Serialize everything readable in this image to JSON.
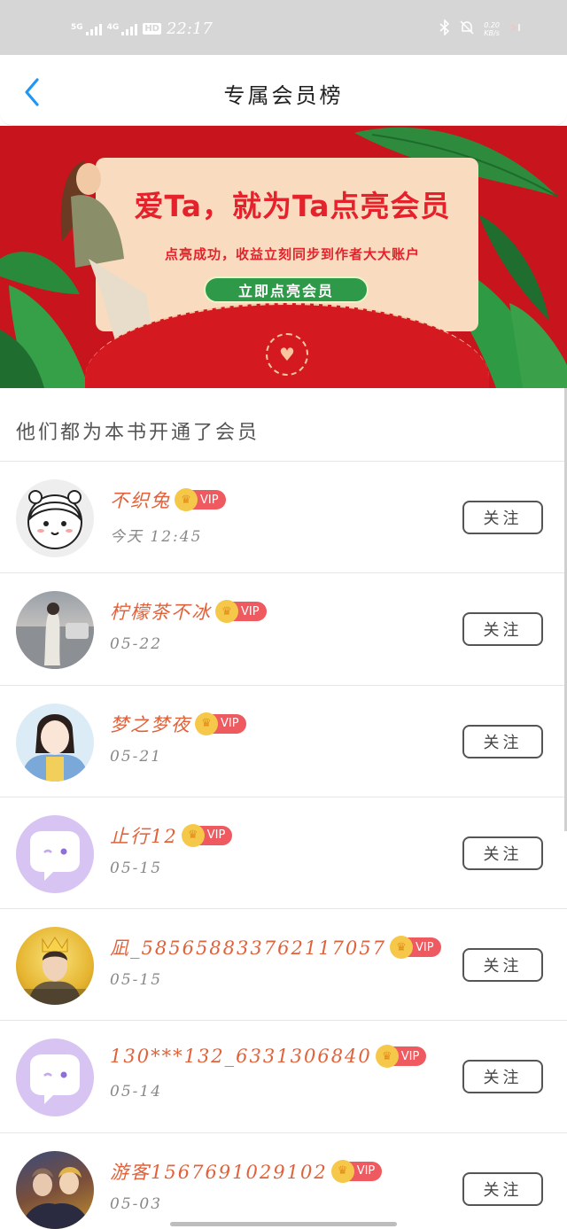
{
  "status_bar": {
    "network_1": "5G",
    "network_2": "4G",
    "hd": "HD",
    "time": "22:17",
    "speed_value": "0.20",
    "speed_unit": "KB/s"
  },
  "header": {
    "title": "专属会员榜",
    "back_icon": "chevron-left-icon"
  },
  "banner": {
    "headline": "爱Ta，就为Ta点亮会员",
    "subline": "点亮成功，收益立刻同步到作者大大账户",
    "button_label": "立即点亮会员"
  },
  "section": {
    "title": "他们都为本书开通了会员"
  },
  "vip_label": "VIP",
  "follow_label": "关注",
  "members": [
    {
      "name": "不织兔",
      "date": "今天 12:45",
      "avatar": "cartoon-girl"
    },
    {
      "name": "柠檬茶不冰",
      "date": "05-22",
      "avatar": "photo-street"
    },
    {
      "name": "梦之梦夜",
      "date": "05-21",
      "avatar": "cartoon-denim"
    },
    {
      "name": "止行12",
      "date": "05-15",
      "avatar": "default-chat"
    },
    {
      "name": "凪_5856588337621170​57",
      "date": "05-15",
      "avatar": "photo-crown"
    },
    {
      "name": "130***132_6331306840",
      "date": "05-14",
      "avatar": "default-chat"
    },
    {
      "name": "游客1567691029102",
      "date": "05-03",
      "avatar": "photo-game"
    }
  ],
  "colors": {
    "banner_red": "#c8141c",
    "name_orange": "#e0613a",
    "vip_red": "#ee5a5f",
    "button_green": "#2e9a49"
  }
}
